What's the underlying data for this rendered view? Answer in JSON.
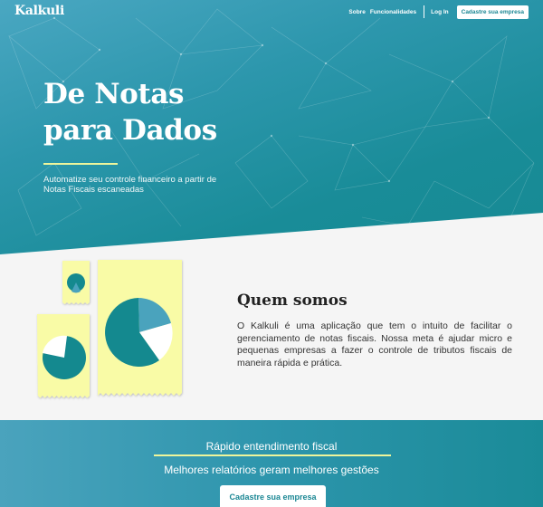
{
  "header": {
    "brand": "Kalkuli",
    "nav": {
      "sobre": "Sobre",
      "funcionalidades": "Funcionalidades",
      "login": "Log In",
      "cta": "Cadastre sua empresa"
    }
  },
  "hero": {
    "title_line1": "De Notas",
    "title_line2": "para Dados",
    "subtitle": "Automatize seu controle financeiro a partir de Notas Fiscais escaneadas"
  },
  "about": {
    "title": "Quem somos",
    "text": "O Kalkuli é uma aplicação que tem o intuito de facilitar o gerenciamento de notas fiscais. Nossa meta é ajudar micro e pequenas empresas a fazer o controle de tributos fiscais de maneira rápida e prática."
  },
  "band": {
    "heading1": "Rápido entendimento fiscal",
    "heading2": "Melhores relatórios geram melhores gestões",
    "cta": "Cadastre sua empresa"
  },
  "colors": {
    "teal": "#168a93",
    "accent_yellow": "#eef59b",
    "receipt": "#f9fba6",
    "pie_dark": "#14898f",
    "pie_light": "#4aa3bd"
  },
  "icons": [
    "network-background",
    "receipt-pie-illustration"
  ]
}
